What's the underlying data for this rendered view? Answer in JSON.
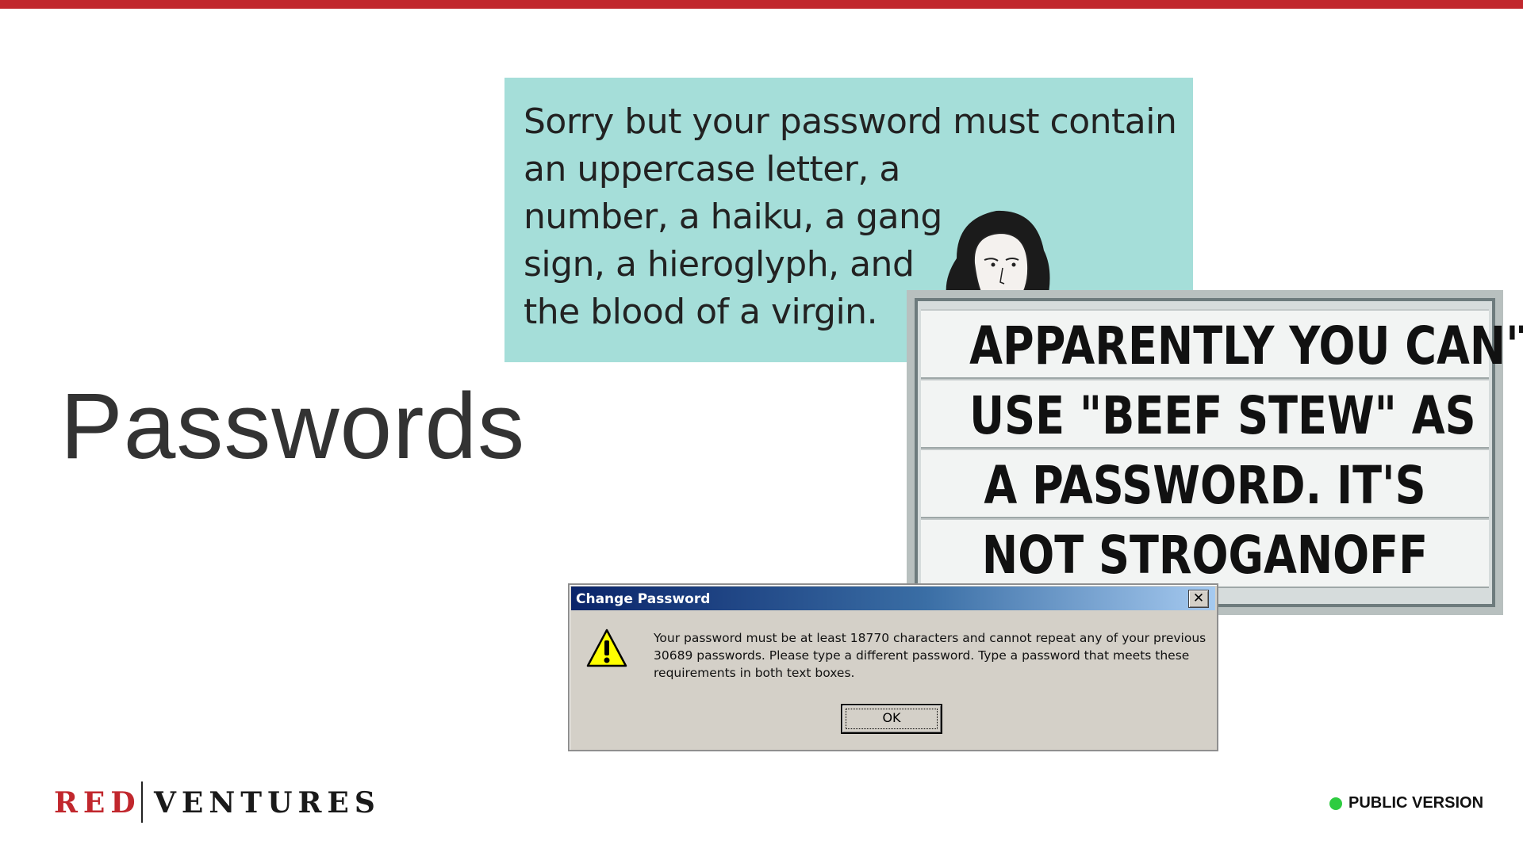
{
  "colors": {
    "accent_red": "#c1272d",
    "status_green": "#2ecc40"
  },
  "slide": {
    "title": "Passwords"
  },
  "ecard": {
    "text": "Sorry but your password must contain\nan uppercase letter, a\nnumber, a haiku, a gang\nsign, a hieroglyph, and\nthe blood of a virgin."
  },
  "sign": {
    "lines": [
      "APPARENTLY YOU CAN'T",
      "USE \"BEEF STEW\" AS",
      "A PASSWORD. IT'S",
      "NOT STROGANOFF"
    ]
  },
  "dialog": {
    "title": "Change Password",
    "close_glyph": "✕",
    "icon": "warning-icon",
    "message": "Your password must be at least 18770 characters and cannot repeat any of your previous 30689 passwords. Please type a different password. Type a password that meets these requirements in both text boxes.",
    "ok_label": "OK"
  },
  "footer": {
    "logo_red": "RED",
    "logo_black": "VENTURES",
    "public_label": "PUBLIC VERSION"
  }
}
